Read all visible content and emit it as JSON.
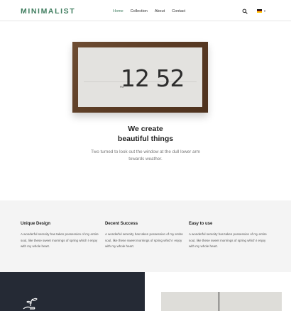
{
  "header": {
    "logo": "MINIMALIST",
    "nav": [
      {
        "label": "Home",
        "active": true
      },
      {
        "label": "Collection",
        "active": false
      },
      {
        "label": "About",
        "active": false
      },
      {
        "label": "Contact",
        "active": false
      }
    ],
    "search_icon": "search-icon",
    "language_icon": "german-flag-icon"
  },
  "hero": {
    "clock_period": "PM",
    "clock_time": "12 52",
    "title_line1": "We create",
    "title_line2": "beautiful things",
    "text": "Two turned to look out the window at the dull lower arm towards weather."
  },
  "features": [
    {
      "title": "Unique Design",
      "text": "A wonderful serenity has taken possession of my entire soul, like these sweet mornings of spring which I enjoy with my whole heart."
    },
    {
      "title": "Decent Success",
      "text": "A wonderful serenity has taken possession of my entire soul, like these sweet mornings of spring which I enjoy with my whole heart."
    },
    {
      "title": "Easy to use",
      "text": "A wonderful serenity has taken possession of my entire soul, like these sweet mornings of spring which I enjoy with my whole heart."
    }
  ],
  "colors": {
    "accent": "#3f7d5f",
    "dark_panel": "#252a35",
    "features_bg": "#f4f4f4"
  }
}
